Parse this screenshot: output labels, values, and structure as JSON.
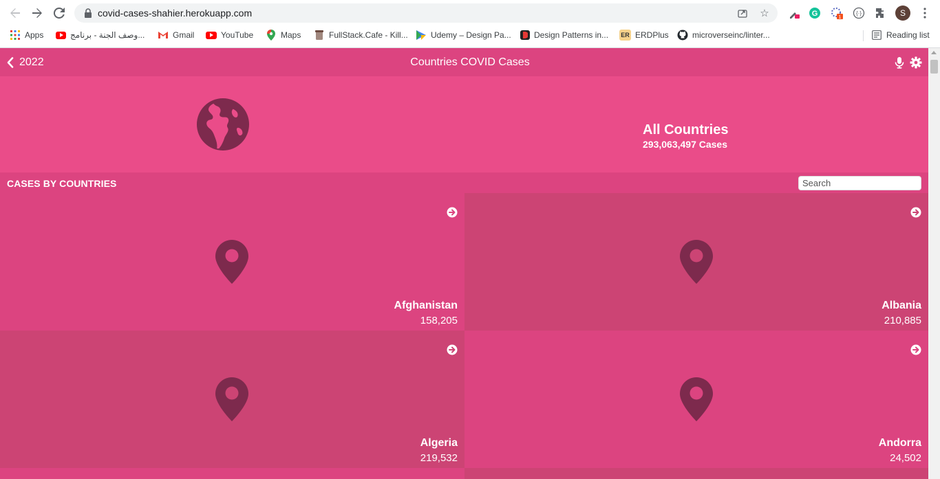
{
  "browser": {
    "url": "covid-cases-shahier.herokuapp.com",
    "bookmarks": [
      {
        "label": "Apps",
        "icon": "apps-grid-icon"
      },
      {
        "label": "وصف الجنة - برنامج...",
        "icon": "youtube-icon"
      },
      {
        "label": "Gmail",
        "icon": "gmail-icon"
      },
      {
        "label": "YouTube",
        "icon": "youtube-icon"
      },
      {
        "label": "Maps",
        "icon": "maps-icon"
      },
      {
        "label": "FullStack.Cafe - Kill...",
        "icon": "fullstack-cafe-icon"
      },
      {
        "label": "Udemy – Design Pa...",
        "icon": "udemy-icon"
      },
      {
        "label": "Design Patterns in...",
        "icon": "refactoring-guru-icon"
      },
      {
        "label": "ERDPlus",
        "icon": "erdplus-icon"
      },
      {
        "label": "microverseinc/linter...",
        "icon": "github-icon"
      }
    ],
    "reading_list": "Reading list",
    "avatar_letter": "S",
    "extension_badge": "1"
  },
  "header": {
    "back_label": "2022",
    "title": "Countries COVID Cases"
  },
  "hero": {
    "name": "All Countries",
    "cases": "293,063,497 Cases"
  },
  "section": {
    "title": "CASES BY COUNTRIES",
    "search_placeholder": "Search"
  },
  "countries": [
    {
      "name": "Afghanistan",
      "cases": "158,205"
    },
    {
      "name": "Albania",
      "cases": "210,885"
    },
    {
      "name": "Algeria",
      "cases": "219,532"
    },
    {
      "name": "Andorra",
      "cases": "24,502"
    }
  ],
  "colors": {
    "primary": "#ea4c89",
    "header": "#dc4480",
    "card_dark": "#cc4474",
    "icon": "#7d2a4d"
  }
}
